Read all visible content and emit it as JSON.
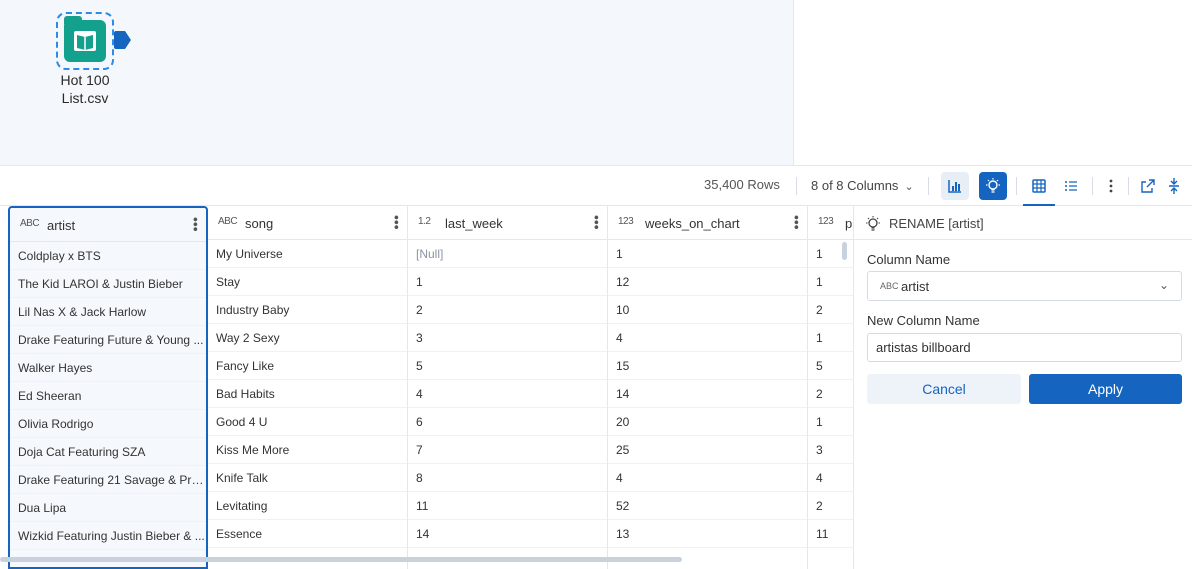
{
  "canvas": {
    "tool_label_line1": "Hot 100",
    "tool_label_line2": "List.csv"
  },
  "toolbar": {
    "rows": "35,400 Rows",
    "columns": "8 of 8 Columns",
    "icons": [
      "bar-chart-icon",
      "lightbulb-icon",
      "grid-view-icon",
      "list-view-icon",
      "more-icon",
      "open-external-icon",
      "collapse-icon"
    ]
  },
  "grid": {
    "columns": [
      {
        "type": "ABC",
        "name": "artist"
      },
      {
        "type": "ABC",
        "name": "song"
      },
      {
        "type": "1.2",
        "name": "last_week"
      },
      {
        "type": "123",
        "name": "weeks_on_chart"
      },
      {
        "type": "123",
        "name": "p"
      }
    ],
    "rows": [
      [
        "Coldplay x BTS",
        "My Universe",
        "[Null]",
        "1",
        "1"
      ],
      [
        "The Kid LAROI & Justin Bieber",
        "Stay",
        "1",
        "12",
        "1"
      ],
      [
        "Lil Nas X & Jack Harlow",
        "Industry Baby",
        "2",
        "10",
        "2"
      ],
      [
        "Drake Featuring Future & Young ...",
        "Way 2 Sexy",
        "3",
        "4",
        "1"
      ],
      [
        "Walker Hayes",
        "Fancy Like",
        "5",
        "15",
        "5"
      ],
      [
        "Ed Sheeran",
        "Bad Habits",
        "4",
        "14",
        "2"
      ],
      [
        "Olivia Rodrigo",
        "Good 4 U",
        "6",
        "20",
        "1"
      ],
      [
        "Doja Cat Featuring SZA",
        "Kiss Me More",
        "7",
        "25",
        "3"
      ],
      [
        "Drake Featuring 21 Savage & Pro...",
        "Knife Talk",
        "8",
        "4",
        "4"
      ],
      [
        "Dua Lipa",
        "Levitating",
        "11",
        "52",
        "2"
      ],
      [
        "Wizkid Featuring Justin Bieber & ...",
        "Essence",
        "14",
        "13",
        "11"
      ]
    ]
  },
  "panel": {
    "title": "RENAME [artist]",
    "column_name_label": "Column Name",
    "column_name_type": "ABC",
    "column_name_value": "artist",
    "new_column_label": "New Column Name",
    "new_column_value": "artistas billboard",
    "cancel_label": "Cancel",
    "apply_label": "Apply"
  },
  "colors": {
    "accent": "#1565c0",
    "tool_green": "#13a08d"
  }
}
